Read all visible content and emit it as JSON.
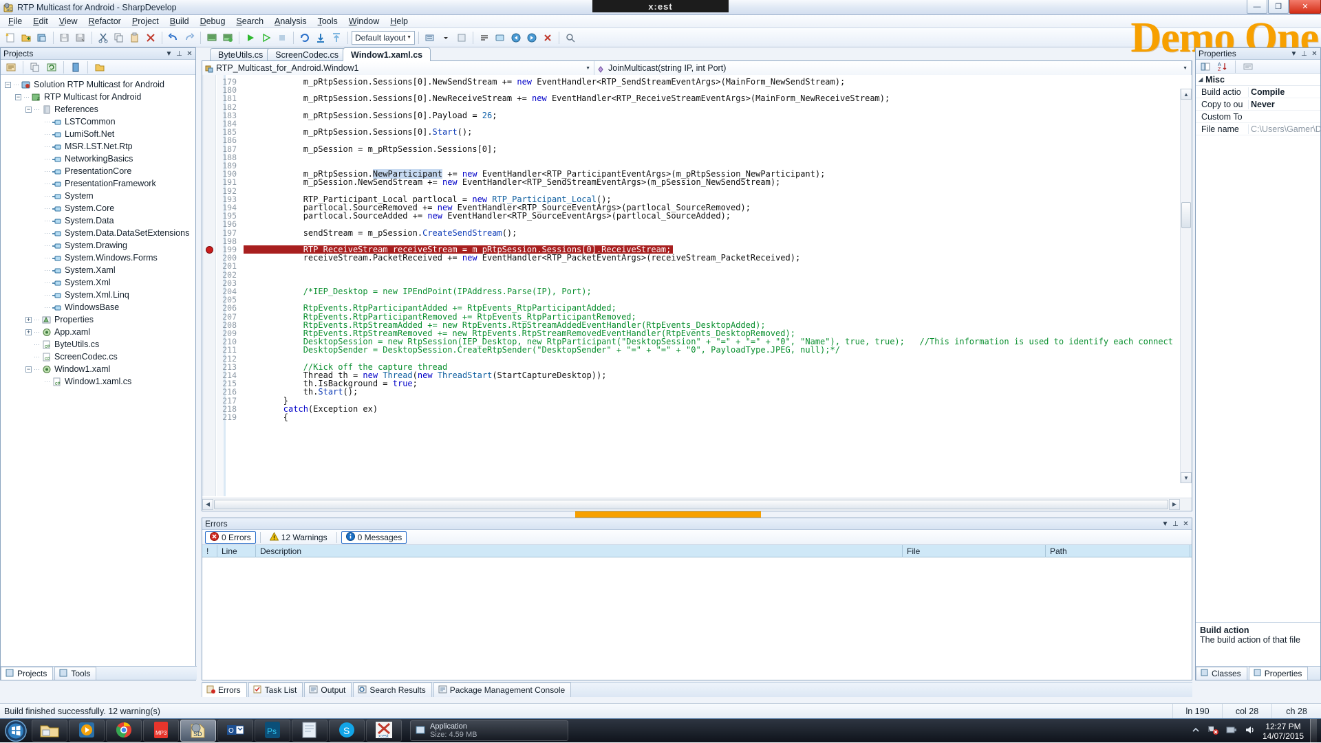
{
  "window": {
    "title": "RTP Multicast for Android - SharpDevelop",
    "shell_label": "x:est",
    "minimize": "—",
    "maximize": "❐",
    "close": "✕",
    "watermark": "Demo One",
    "watermark_number": "1"
  },
  "menu": [
    "File",
    "Edit",
    "View",
    "Refactor",
    "Project",
    "Build",
    "Debug",
    "Search",
    "Analysis",
    "Tools",
    "Window",
    "Help"
  ],
  "toolbar": {
    "layout_label": "Default layout",
    "icons": [
      "new-file-icon",
      "open-file-icon",
      "save-all-icon",
      "save-icon",
      "save-as-icon",
      "cut-icon",
      "copy-icon",
      "paste-icon",
      "delete-icon",
      "undo-icon",
      "redo-icon",
      "build-icon",
      "rebuild-icon",
      "run-icon",
      "run-nodebug-icon",
      "stop-icon",
      "refresh-icon",
      "step-down-icon",
      "step-up-icon",
      "layout-icon",
      "toggle-icon",
      "bookmark-icon",
      "comment-icon",
      "window-icon",
      "nav-back-icon",
      "nav-forward-icon",
      "close-all-icon",
      "search-icon"
    ]
  },
  "projects": {
    "title": "Projects",
    "toolbar_icons": [
      "properties-icon",
      "copy-icon",
      "refresh-icon",
      "show-all-files-icon",
      "collapse-icon"
    ],
    "tree": [
      {
        "label": "Solution RTP Multicast for Android",
        "depth": 0,
        "expander": "minus",
        "icon": "solution-icon"
      },
      {
        "label": "RTP Multicast for Android",
        "depth": 1,
        "expander": "minus",
        "icon": "csproject-icon"
      },
      {
        "label": "References",
        "depth": 2,
        "expander": "minus",
        "icon": "references-icon"
      },
      {
        "label": "LSTCommon",
        "depth": 3,
        "expander": "none",
        "icon": "reference-icon"
      },
      {
        "label": "LumiSoft.Net",
        "depth": 3,
        "expander": "none",
        "icon": "reference-icon"
      },
      {
        "label": "MSR.LST.Net.Rtp",
        "depth": 3,
        "expander": "none",
        "icon": "reference-icon"
      },
      {
        "label": "NetworkingBasics",
        "depth": 3,
        "expander": "none",
        "icon": "reference-icon"
      },
      {
        "label": "PresentationCore",
        "depth": 3,
        "expander": "none",
        "icon": "reference-icon"
      },
      {
        "label": "PresentationFramework",
        "depth": 3,
        "expander": "none",
        "icon": "reference-icon"
      },
      {
        "label": "System",
        "depth": 3,
        "expander": "none",
        "icon": "reference-icon"
      },
      {
        "label": "System.Core",
        "depth": 3,
        "expander": "none",
        "icon": "reference-icon"
      },
      {
        "label": "System.Data",
        "depth": 3,
        "expander": "none",
        "icon": "reference-icon"
      },
      {
        "label": "System.Data.DataSetExtensions",
        "depth": 3,
        "expander": "none",
        "icon": "reference-icon"
      },
      {
        "label": "System.Drawing",
        "depth": 3,
        "expander": "none",
        "icon": "reference-icon"
      },
      {
        "label": "System.Windows.Forms",
        "depth": 3,
        "expander": "none",
        "icon": "reference-icon"
      },
      {
        "label": "System.Xaml",
        "depth": 3,
        "expander": "none",
        "icon": "reference-icon"
      },
      {
        "label": "System.Xml",
        "depth": 3,
        "expander": "none",
        "icon": "reference-icon"
      },
      {
        "label": "System.Xml.Linq",
        "depth": 3,
        "expander": "none",
        "icon": "reference-icon"
      },
      {
        "label": "WindowsBase",
        "depth": 3,
        "expander": "none",
        "icon": "reference-icon"
      },
      {
        "label": "Properties",
        "depth": 2,
        "expander": "plus",
        "icon": "properties-folder-icon"
      },
      {
        "label": "App.xaml",
        "depth": 2,
        "expander": "plus",
        "icon": "xaml-icon"
      },
      {
        "label": "ByteUtils.cs",
        "depth": 2,
        "expander": "none",
        "icon": "cs-icon"
      },
      {
        "label": "ScreenCodec.cs",
        "depth": 2,
        "expander": "none",
        "icon": "cs-icon"
      },
      {
        "label": "Window1.xaml",
        "depth": 2,
        "expander": "minus",
        "icon": "xaml-icon"
      },
      {
        "label": "Window1.xaml.cs",
        "depth": 3,
        "expander": "none",
        "icon": "cs-icon"
      }
    ],
    "bottom_tabs": [
      {
        "label": "Projects",
        "active": true,
        "icon": "projects-icon"
      },
      {
        "label": "Tools",
        "active": false,
        "icon": "tools-icon"
      }
    ]
  },
  "editor": {
    "tabs": [
      {
        "label": "ByteUtils.cs",
        "active": false
      },
      {
        "label": "ScreenCodec.cs",
        "active": false
      },
      {
        "label": "Window1.xaml.cs",
        "active": true
      }
    ],
    "nav_left": "RTP_Multicast_for_Android.Window1",
    "nav_right": "JoinMulticast(string IP, int Port)",
    "breakpoint_line": 199,
    "first_line": 179,
    "lines": [
      {
        "n": 179,
        "html": "            m_pRtpSession.Sessions[0].NewSendStream += <span class='kw'>new</span> EventHandler&lt;RTP_SendStreamEventArgs&gt;(MainForm_NewSendStream);"
      },
      {
        "n": 180,
        "html": ""
      },
      {
        "n": 181,
        "html": "            m_pRtpSession.Sessions[0].NewReceiveStream += <span class='kw'>new</span> EventHandler&lt;RTP_ReceiveStreamEventArgs&gt;(MainForm_NewReceiveStream);"
      },
      {
        "n": 182,
        "html": ""
      },
      {
        "n": 183,
        "html": "            m_pRtpSession.Sessions[0].Payload = <span class='num'>26</span>;"
      },
      {
        "n": 184,
        "html": ""
      },
      {
        "n": 185,
        "html": "            m_pRtpSession.Sessions[0].<span class='fn'>Start</span>();"
      },
      {
        "n": 186,
        "html": ""
      },
      {
        "n": 187,
        "html": "            m_pSession = m_pRtpSession.Sessions[0];"
      },
      {
        "n": 188,
        "html": ""
      },
      {
        "n": 189,
        "html": ""
      },
      {
        "n": 190,
        "html": "            m_pRtpSession.<span class='hl'>NewParticipant</span> += <span class='kw'>new</span> EventHandler&lt;RTP_ParticipantEventArgs&gt;(m_pRtpSession_NewParticipant);"
      },
      {
        "n": 191,
        "html": "            m_pSession.NewSendStream += <span class='kw'>new</span> EventHandler&lt;RTP_SendStreamEventArgs&gt;(m_pSession_NewSendStream);"
      },
      {
        "n": 192,
        "html": ""
      },
      {
        "n": 193,
        "html": "            RTP_Participant_Local partlocal = <span class='kw'>new</span> <span class='typ'>RTP_Participant_Local</span>();"
      },
      {
        "n": 194,
        "html": "            partlocal.SourceRemoved += <span class='kw'>new</span> EventHandler&lt;RTP_SourceEventArgs&gt;(partlocal_SourceRemoved);"
      },
      {
        "n": 195,
        "html": "            partlocal.SourceAdded += <span class='kw'>new</span> EventHandler&lt;RTP_SourceEventArgs&gt;(partlocal_SourceAdded);"
      },
      {
        "n": 196,
        "html": ""
      },
      {
        "n": 197,
        "html": "            sendStream = m_pSession.<span class='fn'>CreateSendStream</span>();"
      },
      {
        "n": 198,
        "html": ""
      },
      {
        "n": 199,
        "html": "            RTP_ReceiveStream receiveStream = m_pRtpSession.Sessions[0].ReceiveStream;",
        "breakpoint": true
      },
      {
        "n": 200,
        "html": "            receiveStream.PacketReceived += <span class='kw'>new</span> EventHandler&lt;RTP_PacketEventArgs&gt;(receiveStream_PacketReceived);"
      },
      {
        "n": 201,
        "html": ""
      },
      {
        "n": 202,
        "html": ""
      },
      {
        "n": 203,
        "html": ""
      },
      {
        "n": 204,
        "html": "<span class='cmt'>            /*IEP_Desktop = new IPEndPoint(IPAddress.Parse(IP), Port);</span>"
      },
      {
        "n": 205,
        "html": ""
      },
      {
        "n": 206,
        "html": "<span class='cmt'>            RtpEvents.RtpParticipantAdded += RtpEvents_RtpParticipantAdded;</span>"
      },
      {
        "n": 207,
        "html": "<span class='cmt'>            RtpEvents.RtpParticipantRemoved += RtpEvents_RtpParticipantRemoved;</span>"
      },
      {
        "n": 208,
        "html": "<span class='cmt'>            RtpEvents.RtpStreamAdded += new RtpEvents.RtpStreamAddedEventHandler(RtpEvents_DesktopAdded);</span>"
      },
      {
        "n": 209,
        "html": "<span class='cmt'>            RtpEvents.RtpStreamRemoved += new RtpEvents.RtpStreamRemovedEventHandler(RtpEvents_DesktopRemoved);</span>"
      },
      {
        "n": 210,
        "html": "<span class='cmt'>            DesktopSession = new RtpSession(IEP_Desktop, new RtpParticipant(\"DesktopSession\" + \"=\" + \"=\" + \"0\", \"Name\"), true, true);   //This information is used to identify each connect</span>"
      },
      {
        "n": 211,
        "html": "<span class='cmt'>            DesktopSender = DesktopSession.CreateRtpSender(\"DesktopSender\" + \"=\" + \"=\" + \"0\", PayloadType.JPEG, null);*/</span>"
      },
      {
        "n": 212,
        "html": ""
      },
      {
        "n": 213,
        "html": "            <span class='cmt'>//Kick off the capture thread</span>"
      },
      {
        "n": 214,
        "html": "            Thread th = <span class='kw'>new</span> <span class='typ'>Thread</span>(<span class='kw'>new</span> <span class='typ'>ThreadStart</span>(StartCaptureDesktop));"
      },
      {
        "n": 215,
        "html": "            th.IsBackground = <span class='kw'>true</span>;"
      },
      {
        "n": 216,
        "html": "            th.<span class='fn'>Start</span>();"
      },
      {
        "n": 217,
        "html": "        }"
      },
      {
        "n": 218,
        "html": "        <span class='kw'>catch</span>(Exception ex)"
      },
      {
        "n": 219,
        "html": "        {"
      }
    ]
  },
  "errors_pad": {
    "title": "Errors",
    "buttons": [
      {
        "label": "0 Errors",
        "icon": "error-icon"
      },
      {
        "label": "12 Warnings",
        "icon": "warning-icon"
      },
      {
        "label": "0 Messages",
        "icon": "info-icon"
      }
    ],
    "columns": [
      "!",
      "Line",
      "Description",
      "File",
      "Path"
    ],
    "rows": []
  },
  "bottom_pads": [
    {
      "label": "Errors",
      "icon": "errors-icon",
      "active": true
    },
    {
      "label": "Task List",
      "icon": "tasklist-icon",
      "active": false
    },
    {
      "label": "Output",
      "icon": "output-icon",
      "active": false
    },
    {
      "label": "Search Results",
      "icon": "search-results-icon",
      "active": false
    },
    {
      "label": "Package Management Console",
      "icon": "package-icon",
      "active": false
    }
  ],
  "properties": {
    "title": "Properties",
    "category": "Misc",
    "rows": [
      {
        "name": "Build actio",
        "value": "Compile",
        "dim": false
      },
      {
        "name": "Copy to ou",
        "value": "Never",
        "dim": false
      },
      {
        "name": "Custom To",
        "value": "",
        "dim": false
      },
      {
        "name": "File name",
        "value": "C:\\Users\\Gamer\\D",
        "dim": true
      }
    ],
    "desc_title": "Build action",
    "desc_text": "The build action of that file",
    "tabs": [
      {
        "label": "Classes",
        "active": false,
        "icon": "classes-icon"
      },
      {
        "label": "Properties",
        "active": true,
        "icon": "properties-icon"
      }
    ]
  },
  "statusbar": {
    "message": "Build finished successfully. 12 warning(s)",
    "line": "ln 190",
    "col": "col 28",
    "ch": "ch 28"
  },
  "taskbar": {
    "start": "start-orb-icon",
    "items": [
      {
        "icon": "explorer-icon",
        "active": false
      },
      {
        "icon": "media-player-icon",
        "active": false
      },
      {
        "icon": "chrome-icon",
        "active": false
      },
      {
        "icon": "mp3-icon",
        "active": false
      },
      {
        "icon": "sharpdevelop-icon",
        "active": true
      },
      {
        "icon": "outlook-icon",
        "active": false
      },
      {
        "icon": "photoshop-icon",
        "active": false
      },
      {
        "icon": "notepad-icon",
        "active": false
      },
      {
        "icon": "skype-icon",
        "active": false
      },
      {
        "icon": "xest-icon",
        "active": false
      }
    ],
    "window_button": {
      "title": "Application",
      "subtitle": "Size: 4.59 MB"
    },
    "tray": [
      "show-hidden-icon",
      "network-error-icon",
      "flash-drive-icon",
      "volume-icon"
    ],
    "time": "12:27 PM",
    "date": "14/07/2015"
  },
  "colors": {
    "accent_orange": "#f7a000",
    "breakpoint_red": "#a81f1f",
    "selection_blue": "#c6d9f0",
    "grid_header": "#cfe8f7"
  }
}
